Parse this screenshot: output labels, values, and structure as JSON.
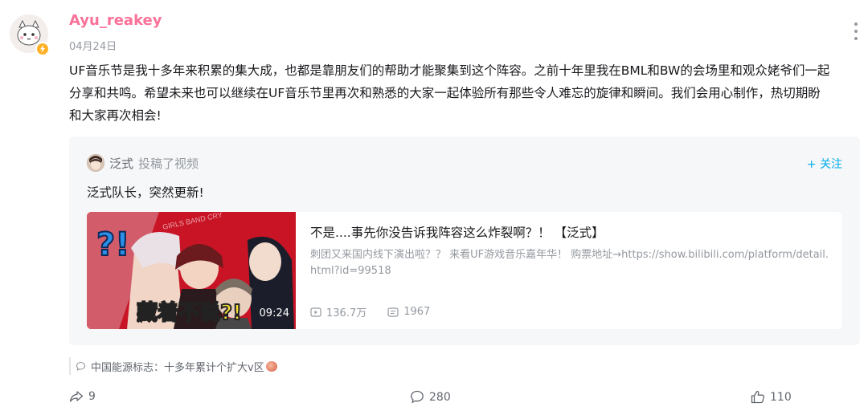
{
  "post": {
    "username": "Ayu_reakey",
    "date": "04月24日",
    "text": "UF音乐节是我十多年来积累的集大成，也都是靠朋友们的帮助才能聚集到这个阵容。之前十年里我在BML和BW的会场里和观众姥爷们一起分享和共鸣。希望未来也可以继续在UF音乐节里再次和熟悉的大家一起体验所有那些令人难忘的旋律和瞬间。我们会用心制作，热切期盼和大家再次相会!"
  },
  "repost": {
    "author": "泛式",
    "action": "投稿了视频",
    "follow_label": "+ 关注",
    "text": "泛式队长，突然更新!",
    "video": {
      "title": "不是....事先你没告诉我阵容这么炸裂啊？！ 【泛式】",
      "description": "刺团又来国内线下演出啦？？ 来看UF游戏音乐嘉年华！ 购票地址→https://show.bilibili.com/platform/detail.html?id=99518",
      "duration": "09:24",
      "thumb_caption": "藏着不说?!",
      "thumb_question": "?!",
      "views": "136.7万",
      "danmaku": "1967"
    }
  },
  "comment_preview": {
    "text": "中国能源标志：十多年累计个扩大v区"
  },
  "actions": {
    "share_count": "9",
    "comment_count": "280",
    "like_count": "110"
  },
  "colors": {
    "username": "#fb7299",
    "follow": "#00aeec",
    "badge": "#ffb027",
    "muted": "#9499a0"
  },
  "icons": [
    "more-icon",
    "lightning-badge-icon",
    "play-icon",
    "danmaku-icon",
    "comment-bubble-icon",
    "share-icon",
    "comment-icon",
    "like-icon"
  ]
}
